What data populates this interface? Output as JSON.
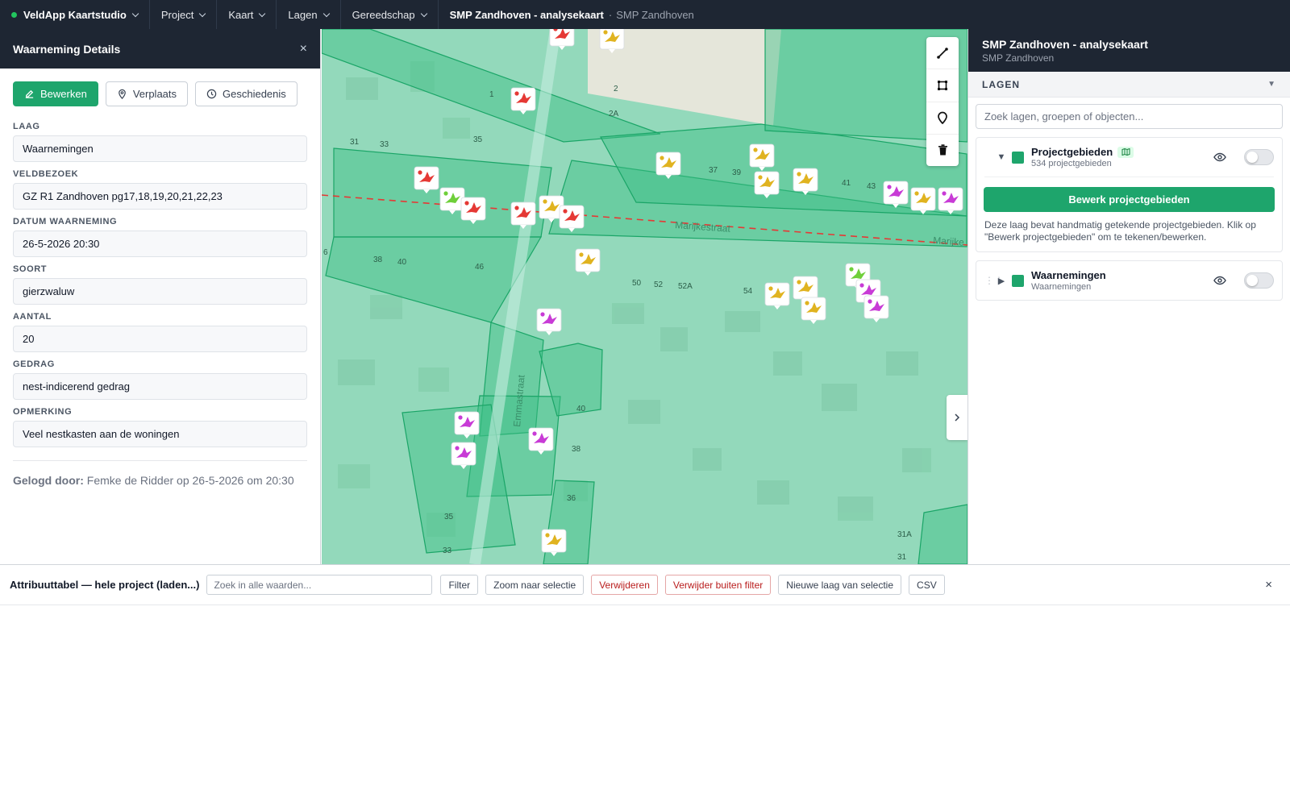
{
  "topbar": {
    "brand": "VeldApp Kaartstudio",
    "menus": [
      "Project",
      "Kaart",
      "Lagen",
      "Gereedschap"
    ],
    "project_title": "SMP Zandhoven - analysekaart",
    "project_subtitle": "SMP Zandhoven",
    "separator": "·"
  },
  "details": {
    "title": "Waarneming Details",
    "close": "×",
    "actions": {
      "edit": "Bewerken",
      "move": "Verplaats",
      "history": "Geschiedenis"
    },
    "fields": [
      {
        "label": "LAAG",
        "value": "Waarnemingen"
      },
      {
        "label": "VELDBEZOEK",
        "value": "GZ R1 Zandhoven pg17,18,19,20,21,22,23"
      },
      {
        "label": "DATUM WAARNEMING",
        "value": "26-5-2026 20:30"
      },
      {
        "label": "SOORT",
        "value": "gierzwaluw"
      },
      {
        "label": "AANTAL",
        "value": "20"
      },
      {
        "label": "GEDRAG",
        "value": "nest-indicerend gedrag"
      },
      {
        "label": "OPMERKING",
        "value": "Veel nestkasten aan de woningen"
      }
    ],
    "logged_label": "Gelogd door:",
    "logged_value": "Femke de Ridder op 26-5-2026 om 20:30"
  },
  "map": {
    "street_labels": [
      "Marijkestraat",
      "Marijke",
      "Emmastraat"
    ],
    "house_numbers": [
      "1",
      "2",
      "2A",
      "31",
      "33",
      "35",
      "37",
      "39",
      "41",
      "43",
      "6",
      "38",
      "40",
      "46",
      "50",
      "52",
      "52A",
      "54",
      "40",
      "38",
      "36",
      "35",
      "33",
      "31A",
      "31"
    ],
    "tools": [
      "line-tool-icon",
      "polygon-tool-icon",
      "marker-tool-icon",
      "trash-icon"
    ],
    "colors": {
      "base": "#93d9bb",
      "polygon": "#3cbf86",
      "red": "#e53935",
      "yellow": "#e0b320",
      "magenta": "#c83bd6",
      "green": "#6fcf3a"
    }
  },
  "layers": {
    "project_title": "SMP Zandhoven - analysekaart",
    "project_subtitle": "SMP Zandhoven",
    "section_label": "LAGEN",
    "section_arrow": "▼",
    "search_placeholder": "Zoek lagen, groepen of objecten...",
    "items": [
      {
        "name": "Projectgebieden",
        "sub": "534 projectgebieden",
        "expanded": true,
        "visible": false
      },
      {
        "name": "Waarnemingen",
        "sub": "Waarnemingen",
        "expanded": false,
        "visible": false
      }
    ],
    "edit_button": "Bewerk projectgebieden",
    "description": "Deze laag bevat handmatig getekende projectgebieden. Klik op \"Bewerk projectgebieden\" om te tekenen/bewerken.",
    "toggle_open": "▼",
    "toggle_closed": "▶",
    "grip": "⋮⋮"
  },
  "attribute_table": {
    "title": "Attribuuttabel — hele project (laden...)",
    "search_placeholder": "Zoek in alle waarden...",
    "buttons": [
      "Filter",
      "Zoom naar selectie",
      "Verwijderen",
      "Verwijder buiten filter",
      "Nieuwe laag van selectie",
      "CSV"
    ],
    "close": "×"
  }
}
